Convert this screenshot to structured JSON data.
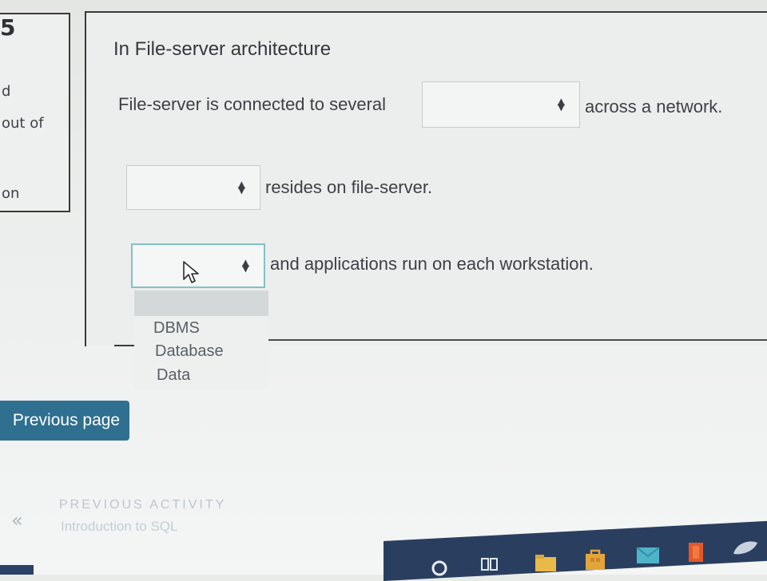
{
  "info_panel": {
    "number": "5",
    "line_1": "d",
    "line_2": "out of",
    "line_3": "on"
  },
  "question": {
    "title": "In File-server architecture",
    "sentence_1_prefix": "File-server is connected to several",
    "sentence_1_suffix": "across a network.",
    "sentence_2_suffix": "resides on file-server.",
    "sentence_3_suffix": "and applications run on each workstation.",
    "select_1_value": "",
    "select_2_value": "",
    "select_3_value": ""
  },
  "dropdown": {
    "options": [
      "DBMS",
      "Database",
      "Data"
    ]
  },
  "navigation": {
    "previous_page_label": "Previous page",
    "previous_activity_label": "PREVIOUS ACTIVITY",
    "previous_activity_name": "Introduction to SQL"
  },
  "icons": {
    "select_arrows": "up-down-arrows-icon",
    "cursor": "mouse-pointer-icon",
    "prev_activity": "double-chevron-left-icon"
  },
  "colors": {
    "button_bg": "#2f6f8f",
    "focus_border": "#7fc3c6",
    "taskbar": "#2a3f5f"
  }
}
